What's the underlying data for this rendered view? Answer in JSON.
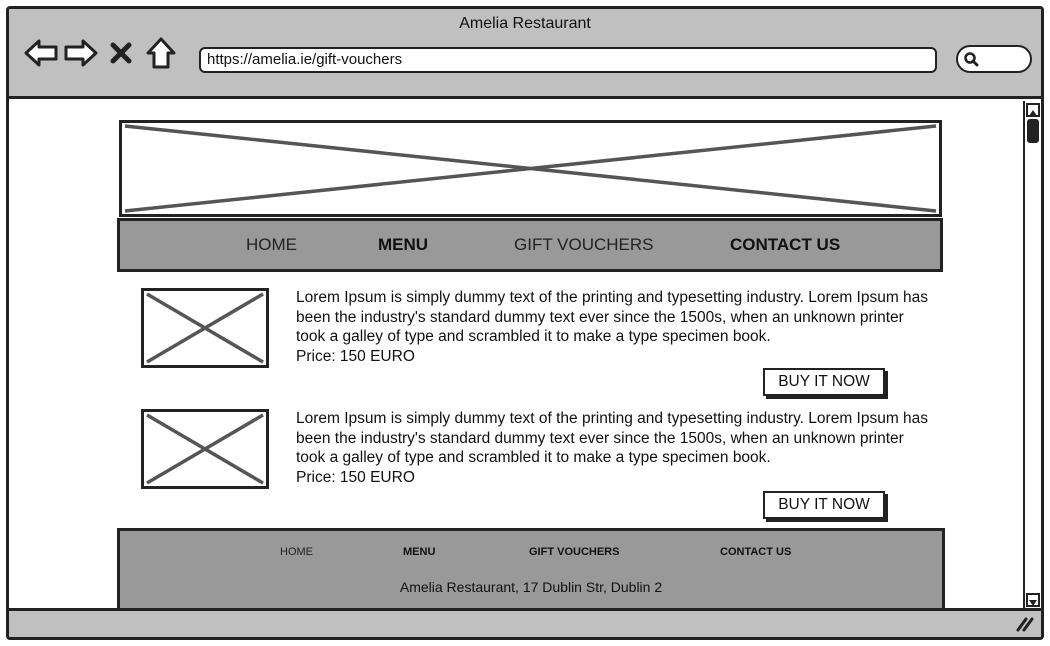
{
  "window": {
    "title": "Amelia Restaurant"
  },
  "browser": {
    "url": "https://amelia.ie/gift-vouchers",
    "icons": [
      "back-arrow-icon",
      "forward-arrow-icon",
      "close-x-icon",
      "home-icon",
      "search-icon",
      "resize-grip-icon"
    ]
  },
  "nav": {
    "items": [
      {
        "label": "HOME",
        "bold": false
      },
      {
        "label": "MENU",
        "bold": true
      },
      {
        "label": "GIFT VOUCHERS",
        "bold": false
      },
      {
        "label": "CONTACT US",
        "bold": true
      }
    ]
  },
  "products": [
    {
      "text": "Lorem Ipsum is simply dummy text of the printing and typesetting industry. Lorem Ipsum has been the industry's standard dummy text ever since the 1500s, when an unknown printer took a galley of type and scrambled it to make a type specimen book.",
      "price": "Price: 150 EURO",
      "button": "BUY IT NOW"
    },
    {
      "text": "Lorem Ipsum is simply dummy text of the printing and typesetting industry. Lorem Ipsum has been the industry's standard dummy text ever since the 1500s, when an unknown printer took a galley of type and scrambled it to make a type specimen book.",
      "price": "Price: 150 EURO",
      "button": "BUY IT NOW"
    }
  ],
  "footer": {
    "items": [
      {
        "label": "HOME",
        "bold": false
      },
      {
        "label": "MENU",
        "bold": true
      },
      {
        "label": "GIFT VOUCHERS",
        "bold": true
      },
      {
        "label": "CONTACT US",
        "bold": true
      }
    ],
    "address": "Amelia Restaurant, 17 Dublin Str, Dublin 2"
  },
  "colors": {
    "chrome": "#c0c0c0",
    "nav_bg": "#999999",
    "ink": "#222222",
    "placeholder_x": "#555555"
  }
}
